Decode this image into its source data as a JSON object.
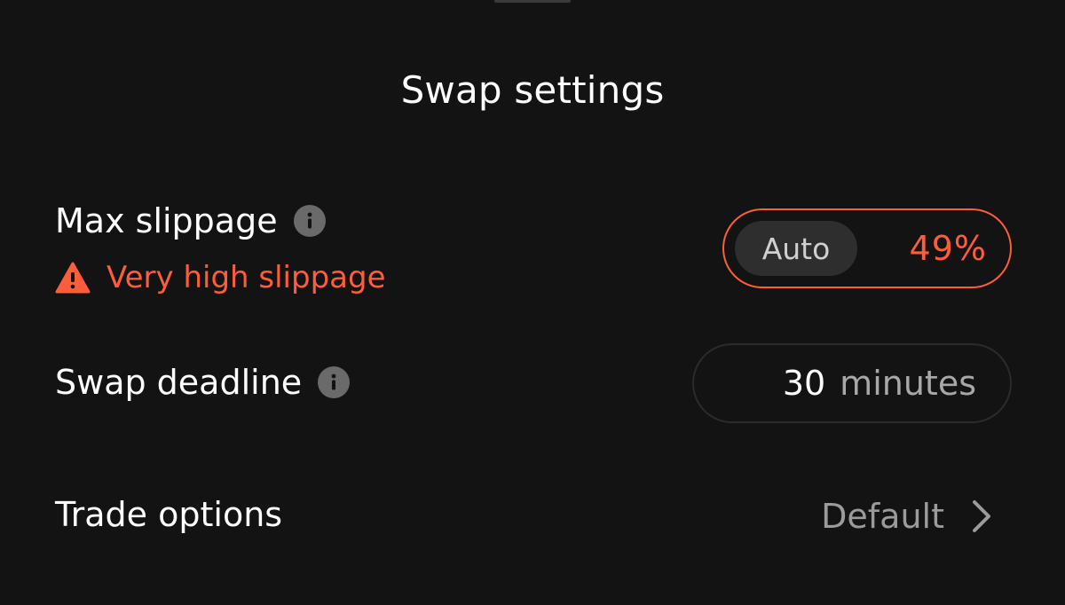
{
  "title": "Swap settings",
  "max_slippage": {
    "label": "Max slippage",
    "info_icon": "info-icon",
    "warning": {
      "icon": "warning-triangle-icon",
      "text": "Very high slippage"
    },
    "auto_label": "Auto",
    "value": "49%"
  },
  "swap_deadline": {
    "label": "Swap deadline",
    "info_icon": "info-icon",
    "value": "30",
    "unit": "minutes"
  },
  "trade_options": {
    "label": "Trade options",
    "value": "Default",
    "icon": "chevron-right-icon"
  },
  "colors": {
    "background": "#131313",
    "accent_warning": "#fe5d3c",
    "text_primary": "#ffffff",
    "text_secondary": "#9b9b9b"
  }
}
